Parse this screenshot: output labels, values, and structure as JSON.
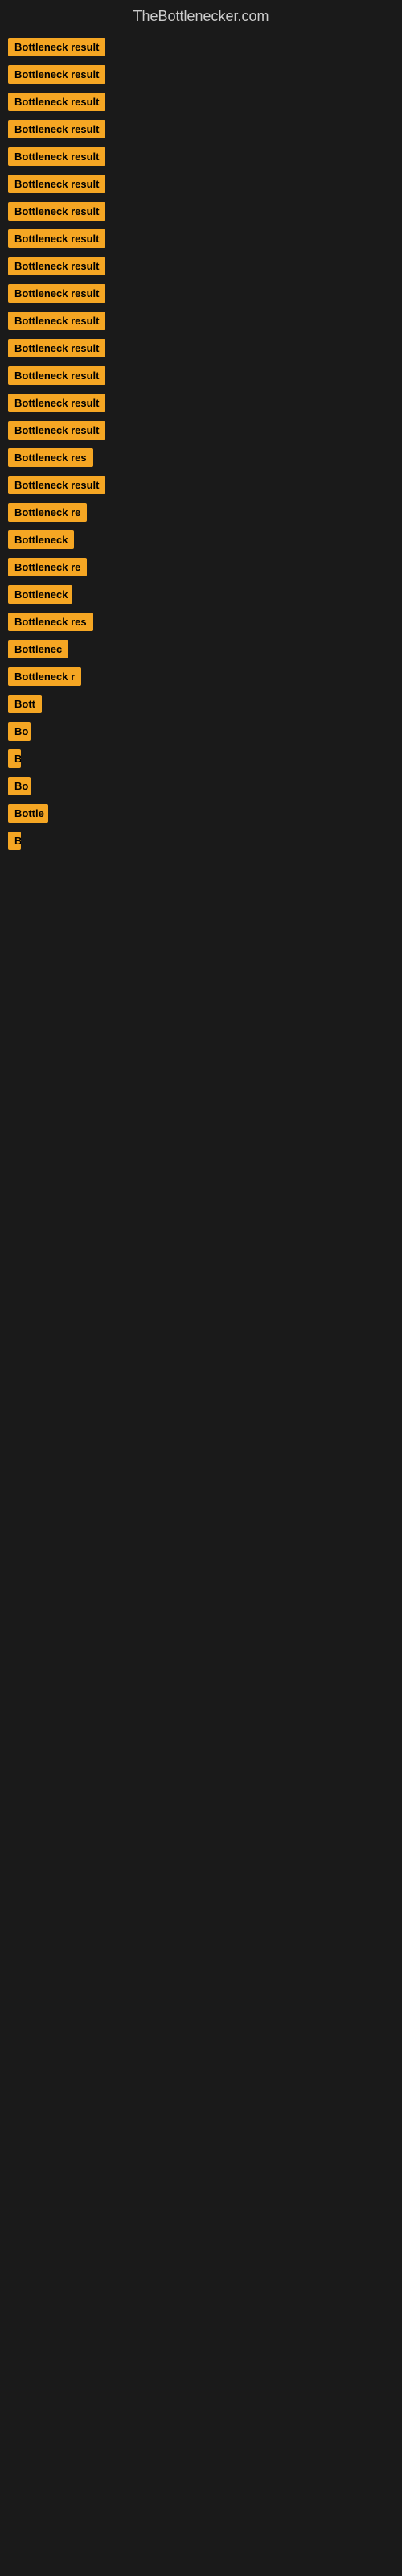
{
  "site": {
    "title": "TheBottlenecker.com"
  },
  "items": [
    {
      "label": "Bottleneck result",
      "width": 130
    },
    {
      "label": "Bottleneck result",
      "width": 130
    },
    {
      "label": "Bottleneck result",
      "width": 130
    },
    {
      "label": "Bottleneck result",
      "width": 130
    },
    {
      "label": "Bottleneck result",
      "width": 130
    },
    {
      "label": "Bottleneck result",
      "width": 130
    },
    {
      "label": "Bottleneck result",
      "width": 130
    },
    {
      "label": "Bottleneck result",
      "width": 130
    },
    {
      "label": "Bottleneck result",
      "width": 130
    },
    {
      "label": "Bottleneck result",
      "width": 130
    },
    {
      "label": "Bottleneck result",
      "width": 130
    },
    {
      "label": "Bottleneck result",
      "width": 130
    },
    {
      "label": "Bottleneck result",
      "width": 130
    },
    {
      "label": "Bottleneck result",
      "width": 130
    },
    {
      "label": "Bottleneck result",
      "width": 130
    },
    {
      "label": "Bottleneck res",
      "width": 110
    },
    {
      "label": "Bottleneck result",
      "width": 125
    },
    {
      "label": "Bottleneck re",
      "width": 100
    },
    {
      "label": "Bottleneck",
      "width": 85
    },
    {
      "label": "Bottleneck re",
      "width": 100
    },
    {
      "label": "Bottleneck",
      "width": 80
    },
    {
      "label": "Bottleneck res",
      "width": 108
    },
    {
      "label": "Bottlenec",
      "width": 75
    },
    {
      "label": "Bottleneck r",
      "width": 95
    },
    {
      "label": "Bott",
      "width": 42
    },
    {
      "label": "Bo",
      "width": 28
    },
    {
      "label": "B",
      "width": 14
    },
    {
      "label": "Bo",
      "width": 28
    },
    {
      "label": "Bottle",
      "width": 50
    },
    {
      "label": "B",
      "width": 12
    }
  ]
}
